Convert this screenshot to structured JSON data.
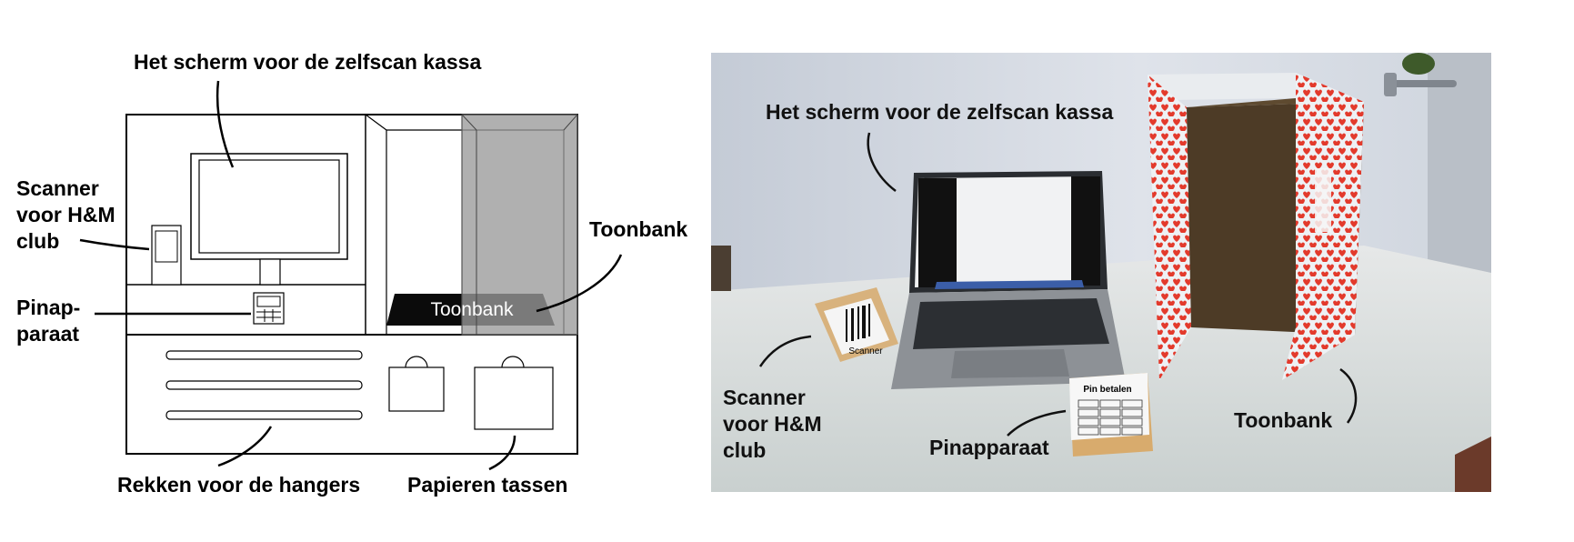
{
  "sketch": {
    "labels": {
      "screen": "Het scherm voor de zelfscan kassa",
      "scanner_l1": "Scanner",
      "scanner_l2": "voor H&M",
      "scanner_l3": "club",
      "pin_l1": "Pinap-",
      "pin_l2": "paraat",
      "counter": "Toonbank",
      "counter_inner": "Toonbank",
      "racks": "Rekken voor de hangers",
      "bags": "Papieren tassen"
    }
  },
  "photo": {
    "labels": {
      "screen": "Het scherm voor de zelfscan kassa",
      "scanner_l1": "Scanner",
      "scanner_l2": "voor H&M",
      "scanner_l3": "club",
      "pin": "Pinapparaat",
      "counter": "Toonbank"
    },
    "props": {
      "scanner_card": "Scanner",
      "pin_card": "Pin betalen"
    }
  }
}
